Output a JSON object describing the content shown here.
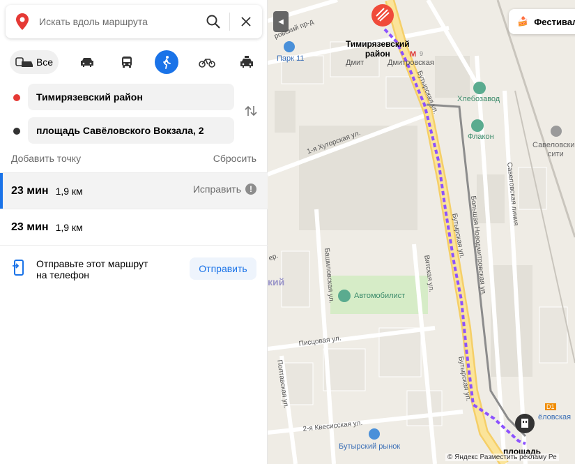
{
  "search": {
    "placeholder": "Искать вдоль маршрута"
  },
  "modes": {
    "all_label": "Все"
  },
  "points": {
    "from": "Тимирязевский район",
    "to": "площадь Савёловского Вокзала, 2"
  },
  "actions": {
    "add_point": "Добавить точку",
    "reset": "Сбросить"
  },
  "routes": [
    {
      "time": "23 мин",
      "distance": "1,9 км",
      "fix_label": "Исправить"
    },
    {
      "time": "23 мин",
      "distance": "1,9 км"
    }
  ],
  "send": {
    "text_line1": "Отправьте этот маршрут",
    "text_line2": "на телефон",
    "button": "Отправить"
  },
  "map": {
    "festival": "Фестивал",
    "district_line1": "Тимирязевский",
    "district_line2": "район",
    "metro_a": "Дмит",
    "metro_b": "Дмитровская",
    "park": "Парк 11",
    "khlebozavod": "Хлебозавод",
    "flakon": "Флакон",
    "savelovsky_city_1": "Савеловский",
    "savelovsky_city_2": "сити",
    "automobilist": "Автомобилист",
    "butyrsky_market": "Бутырский рынок",
    "savelovskaya": "ёловская",
    "ploshchad": "площадь",
    "district_fragment": "кий",
    "metro_line_num": "9",
    "station_badge": "D1",
    "street_proezd": "ровский пр-д",
    "street_khutorskaya": "1-я Хуторская ул.",
    "street_bashilovskaya": "Башиловская ул.",
    "street_vatskaya": "Вятская ул.",
    "street_butyrskaya_1": "Бутырская ул.",
    "street_butyrskaya_2": "Бутырская ул.",
    "street_butyrskaya_3": "Бутырская ул.",
    "street_piscovaya": "Писцовая ул.",
    "street_poltavskaya": "Полтавская ул.",
    "street_kvesisskaya": "2-я Квесисская ул.",
    "street_savelovskaya_line": "Савеловская линия",
    "street_novodmitrovskaya": "Большая Новодмитровская ул.",
    "street_fragment_ger": "ер.",
    "copyright": "© Яндекс   Разместить рекламу   Ре"
  },
  "colors": {
    "accent": "#1a73e8",
    "route": "#8c52ff",
    "road_major": "#f7d774",
    "start_dot": "#e53935"
  }
}
